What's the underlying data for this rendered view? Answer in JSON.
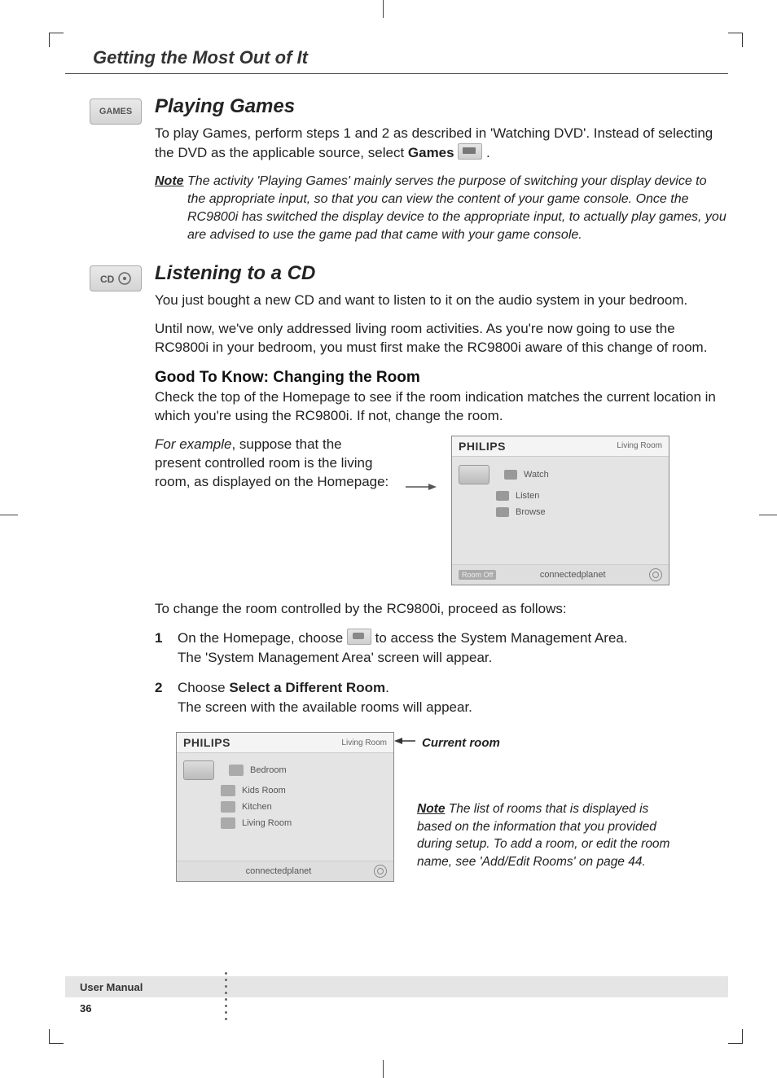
{
  "page_header": "Getting the Most Out of It",
  "sections": {
    "games": {
      "badge": "GAMES",
      "heading": "Playing Games",
      "intro_a": "To play Games, perform steps 1 and 2 as described in 'Watching DVD'. Instead of selecting the DVD as the applicable source, select ",
      "intro_bold": "Games",
      "intro_b": " .",
      "note_label": "Note",
      "note_text": "The activity 'Playing Games' mainly serves the purpose of switching your display device to the appropriate input, so that you can view the content of your game console. Once the RC9800i has switched the display device to the appropriate input, to actually play games, you are advised to use the game pad that came with your game console."
    },
    "cd": {
      "heading": "Listening to a CD",
      "p1": "You just bought a new CD and want to listen to it on the audio system in your bedroom.",
      "p2": "Until now, we've only addressed living room activities. As you're now going to use the RC9800i in your bedroom, you must first make the RC9800i aware of this change of room.",
      "gtk_heading": "Good To Know: Changing the Room",
      "gtk_p": "Check the top of the Homepage to see if the room indication matches the current location in which you're using the RC9800i. If not, change the room.",
      "example_lead_italic": "For example",
      "example_rest": ", suppose that the present controlled room is the living room, as displayed on the Homepage:",
      "homepage_screen": {
        "brand": "PHILIPS",
        "room": "Living Room",
        "items": [
          "Watch",
          "Listen",
          "Browse"
        ],
        "bottom_left": "Room Off",
        "bottom_center": "connectedplanet"
      },
      "change_room_intro": "To change the room controlled by the RC9800i, proceed as follows:",
      "steps": [
        {
          "num": "1",
          "line1_a": "On the Homepage, choose ",
          "line1_b": " to access the System Management Area.",
          "line2": "The 'System Management Area' screen will appear."
        },
        {
          "num": "2",
          "line1_a": "Choose ",
          "line1_bold": "Select a Different Room",
          "line1_b": ".",
          "line2": "The screen with the available rooms will appear."
        }
      ],
      "rooms_screen": {
        "brand": "PHILIPS",
        "room": "Living Room",
        "rooms": [
          "Bedroom",
          "Kids Room",
          "Kitchen",
          "Living Room"
        ],
        "bottom_center": "connectedplanet"
      },
      "current_room_label": "Current room",
      "rooms_note_label": "Note",
      "rooms_note_text": "The list of rooms that is displayed is based on the information that you provided during setup. To add a room, or edit the room name, see 'Add/Edit Rooms' on page 44."
    }
  },
  "footer": {
    "label": "User Manual",
    "page": "36"
  }
}
